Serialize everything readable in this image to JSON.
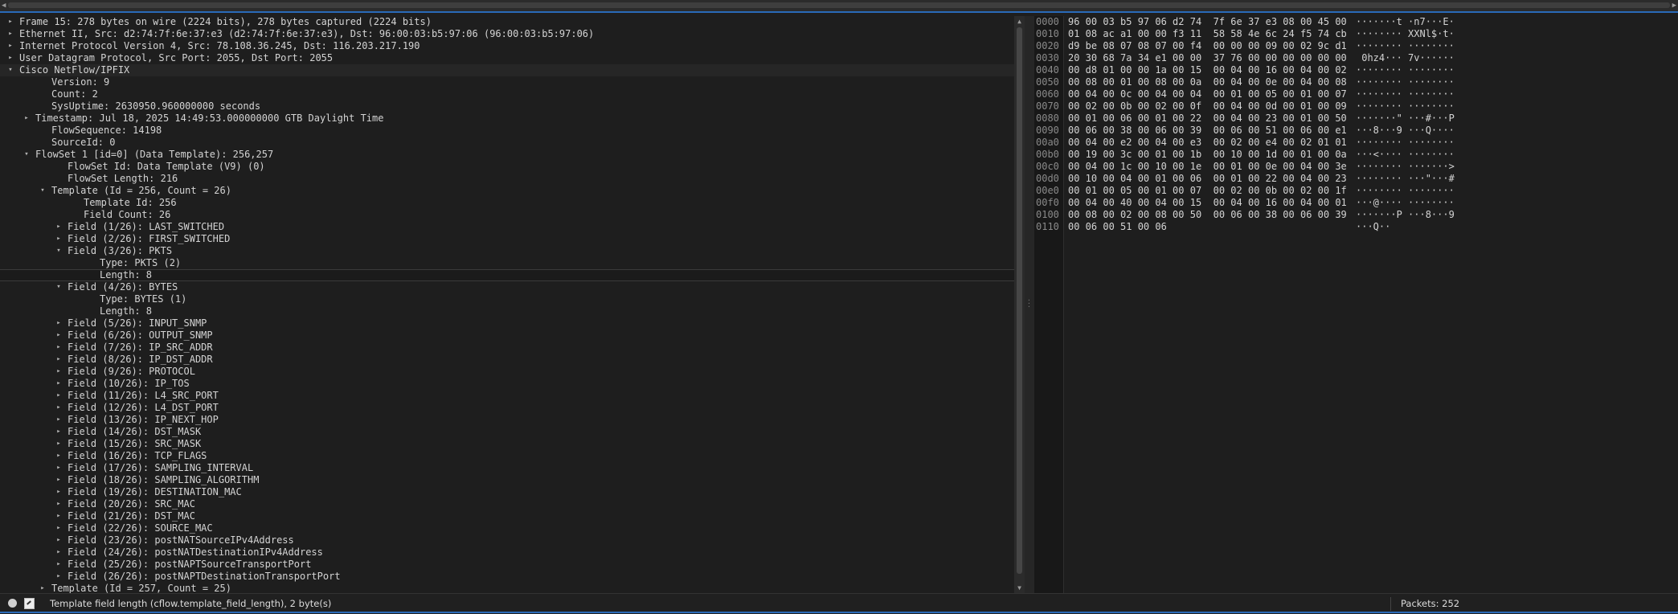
{
  "tree": {
    "rows": [
      {
        "depth": 0,
        "exp": "c",
        "text": "Frame 15: 278 bytes on wire (2224 bits), 278 bytes captured (2224 bits)"
      },
      {
        "depth": 0,
        "exp": "c",
        "text": "Ethernet II, Src: d2:74:7f:6e:37:e3 (d2:74:7f:6e:37:e3), Dst: 96:00:03:b5:97:06 (96:00:03:b5:97:06)"
      },
      {
        "depth": 0,
        "exp": "c",
        "text": "Internet Protocol Version 4, Src: 78.108.36.245, Dst: 116.203.217.190"
      },
      {
        "depth": 0,
        "exp": "c",
        "text": "User Datagram Protocol, Src Port: 2055, Dst Port: 2055"
      },
      {
        "depth": 0,
        "exp": "o",
        "text": "Cisco NetFlow/IPFIX",
        "hdr": true
      },
      {
        "depth": 2,
        "exp": "",
        "text": "Version: 9"
      },
      {
        "depth": 2,
        "exp": "",
        "text": "Count: 2"
      },
      {
        "depth": 2,
        "exp": "",
        "text": "SysUptime: 2630950.960000000 seconds"
      },
      {
        "depth": 1,
        "exp": "c",
        "text": "Timestamp: Jul 18, 2025 14:49:53.000000000 GTB Daylight Time"
      },
      {
        "depth": 2,
        "exp": "",
        "text": "FlowSequence: 14198"
      },
      {
        "depth": 2,
        "exp": "",
        "text": "SourceId: 0"
      },
      {
        "depth": 1,
        "exp": "o",
        "text": "FlowSet 1 [id=0] (Data Template): 256,257"
      },
      {
        "depth": 3,
        "exp": "",
        "text": "FlowSet Id: Data Template (V9) (0)"
      },
      {
        "depth": 3,
        "exp": "",
        "text": "FlowSet Length: 216"
      },
      {
        "depth": 2,
        "exp": "o",
        "text": "Template (Id = 256, Count = 26)"
      },
      {
        "depth": 4,
        "exp": "",
        "text": "Template Id: 256"
      },
      {
        "depth": 4,
        "exp": "",
        "text": "Field Count: 26"
      },
      {
        "depth": 3,
        "exp": "c",
        "text": "Field (1/26): LAST_SWITCHED"
      },
      {
        "depth": 3,
        "exp": "c",
        "text": "Field (2/26): FIRST_SWITCHED"
      },
      {
        "depth": 3,
        "exp": "o",
        "text": "Field (3/26): PKTS"
      },
      {
        "depth": 5,
        "exp": "",
        "text": "Type: PKTS (2)"
      },
      {
        "depth": 5,
        "exp": "",
        "text": "Length: 8",
        "sel": true
      },
      {
        "depth": 3,
        "exp": "o",
        "text": "Field (4/26): BYTES"
      },
      {
        "depth": 5,
        "exp": "",
        "text": "Type: BYTES (1)"
      },
      {
        "depth": 5,
        "exp": "",
        "text": "Length: 8"
      },
      {
        "depth": 3,
        "exp": "c",
        "text": "Field (5/26): INPUT_SNMP"
      },
      {
        "depth": 3,
        "exp": "c",
        "text": "Field (6/26): OUTPUT_SNMP"
      },
      {
        "depth": 3,
        "exp": "c",
        "text": "Field (7/26): IP_SRC_ADDR"
      },
      {
        "depth": 3,
        "exp": "c",
        "text": "Field (8/26): IP_DST_ADDR"
      },
      {
        "depth": 3,
        "exp": "c",
        "text": "Field (9/26): PROTOCOL"
      },
      {
        "depth": 3,
        "exp": "c",
        "text": "Field (10/26): IP_TOS"
      },
      {
        "depth": 3,
        "exp": "c",
        "text": "Field (11/26): L4_SRC_PORT"
      },
      {
        "depth": 3,
        "exp": "c",
        "text": "Field (12/26): L4_DST_PORT"
      },
      {
        "depth": 3,
        "exp": "c",
        "text": "Field (13/26): IP_NEXT_HOP"
      },
      {
        "depth": 3,
        "exp": "c",
        "text": "Field (14/26): DST_MASK"
      },
      {
        "depth": 3,
        "exp": "c",
        "text": "Field (15/26): SRC_MASK"
      },
      {
        "depth": 3,
        "exp": "c",
        "text": "Field (16/26): TCP_FLAGS"
      },
      {
        "depth": 3,
        "exp": "c",
        "text": "Field (17/26): SAMPLING_INTERVAL"
      },
      {
        "depth": 3,
        "exp": "c",
        "text": "Field (18/26): SAMPLING_ALGORITHM"
      },
      {
        "depth": 3,
        "exp": "c",
        "text": "Field (19/26): DESTINATION_MAC"
      },
      {
        "depth": 3,
        "exp": "c",
        "text": "Field (20/26): SRC_MAC"
      },
      {
        "depth": 3,
        "exp": "c",
        "text": "Field (21/26): DST_MAC"
      },
      {
        "depth": 3,
        "exp": "c",
        "text": "Field (22/26): SOURCE_MAC"
      },
      {
        "depth": 3,
        "exp": "c",
        "text": "Field (23/26): postNATSourceIPv4Address"
      },
      {
        "depth": 3,
        "exp": "c",
        "text": "Field (24/26): postNATDestinationIPv4Address"
      },
      {
        "depth": 3,
        "exp": "c",
        "text": "Field (25/26): postNAPTSourceTransportPort"
      },
      {
        "depth": 3,
        "exp": "c",
        "text": "Field (26/26): postNAPTDestinationTransportPort"
      },
      {
        "depth": 2,
        "exp": "c",
        "text": "Template (Id = 257, Count = 25)"
      }
    ]
  },
  "hex": {
    "rows": [
      {
        "offset": "0000",
        "bytes": "96 00 03 b5 97 06 d2 74  7f 6e 37 e3 08 00 45 00",
        "ascii": "·······t ·n7···E·"
      },
      {
        "offset": "0010",
        "bytes": "01 08 ac a1 00 00 f3 11  58 58 4e 6c 24 f5 74 cb",
        "ascii": "········ XXNl$·t·"
      },
      {
        "offset": "0020",
        "bytes": "d9 be 08 07 08 07 00 f4  00 00 00 09 00 02 9c d1",
        "ascii": "········ ········"
      },
      {
        "offset": "0030",
        "bytes": "20 30 68 7a 34 e1 00 00  37 76 00 00 00 00 00 00",
        "ascii": " 0hz4··· 7v······"
      },
      {
        "offset": "0040",
        "bytes": "00 d8 01 00 00 1a 00 15  00 04 00 16 00 04 00 02",
        "ascii": "········ ········"
      },
      {
        "offset": "0050",
        "bytes": "00 08 00 01 00 08 00 0a  00 04 00 0e 00 04 00 08",
        "ascii": "········ ········"
      },
      {
        "offset": "0060",
        "bytes": "00 04 00 0c 00 04 00 04  00 01 00 05 00 01 00 07",
        "ascii": "········ ········"
      },
      {
        "offset": "0070",
        "bytes": "00 02 00 0b 00 02 00 0f  00 04 00 0d 00 01 00 09",
        "ascii": "········ ········"
      },
      {
        "offset": "0080",
        "bytes": "00 01 00 06 00 01 00 22  00 04 00 23 00 01 00 50",
        "ascii": "·······\" ···#···P"
      },
      {
        "offset": "0090",
        "bytes": "00 06 00 38 00 06 00 39  00 06 00 51 00 06 00 e1",
        "ascii": "···8···9 ···Q····"
      },
      {
        "offset": "00a0",
        "bytes": "00 04 00 e2 00 04 00 e3  00 02 00 e4 00 02 01 01",
        "ascii": "········ ········"
      },
      {
        "offset": "00b0",
        "bytes": "00 19 00 3c 00 01 00 1b  00 10 00 1d 00 01 00 0a",
        "ascii": "···<···· ········"
      },
      {
        "offset": "00c0",
        "bytes": "00 04 00 1c 00 10 00 1e  00 01 00 0e 00 04 00 3e",
        "ascii": "········ ·······>"
      },
      {
        "offset": "00d0",
        "bytes": "00 10 00 04 00 01 00 06  00 01 00 22 00 04 00 23",
        "ascii": "········ ···\"···#"
      },
      {
        "offset": "00e0",
        "bytes": "00 01 00 05 00 01 00 07  00 02 00 0b 00 02 00 1f",
        "ascii": "········ ········"
      },
      {
        "offset": "00f0",
        "bytes": "00 04 00 40 00 04 00 15  00 04 00 16 00 04 00 01",
        "ascii": "···@···· ········"
      },
      {
        "offset": "0100",
        "bytes": "00 08 00 02 00 08 00 50  00 06 00 38 00 06 00 39",
        "ascii": "·······P ···8···9"
      },
      {
        "offset": "0110",
        "bytes": "00 06 00 51 00 06",
        "ascii": "···Q··"
      }
    ]
  },
  "status": {
    "message": "Template field length (cflow.template_field_length), 2 byte(s)",
    "packets": "Packets: 252"
  },
  "icons": {
    "expanded": "▾",
    "collapsed": "▸",
    "scroll_up": "▲",
    "scroll_down": "▼",
    "scroll_left": "◀",
    "scroll_right": "▶"
  },
  "colors": {
    "accent": "#2a6ab8",
    "background": "#1e1e1e",
    "text": "#d4d4d4"
  }
}
